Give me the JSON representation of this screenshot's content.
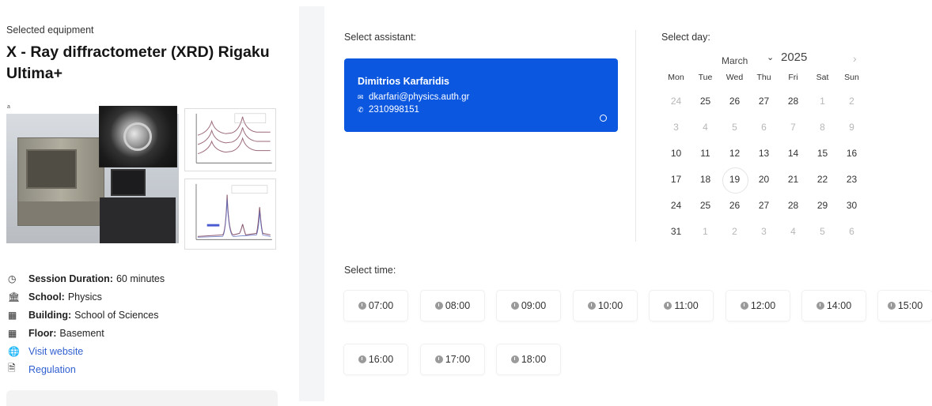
{
  "equipment": {
    "section_label": "Selected equipment",
    "title": "X - Ray diffractometer (XRD) Rigaku Ultima+",
    "details": [
      {
        "icon": "clock-icon",
        "label": "Session Duration:",
        "value": "60 minutes"
      },
      {
        "icon": "bank-icon",
        "label": "School:",
        "value": "Physics"
      },
      {
        "icon": "building-icon",
        "label": "Building:",
        "value": "School of Sciences"
      },
      {
        "icon": "building-icon",
        "label": "Floor:",
        "value": "Basement"
      }
    ],
    "links": [
      {
        "icon": "globe-icon",
        "text": "Visit website"
      },
      {
        "icon": "file-icon",
        "text": "Regulation"
      }
    ]
  },
  "assistant": {
    "section_label": "Select assistant:",
    "name": "Dimitrios Karfaridis",
    "email": "dkarfari@physics.auth.gr",
    "phone": "2310998151"
  },
  "calendar": {
    "section_label": "Select day:",
    "month": "March",
    "year": "2025",
    "weekdays": [
      "Mon",
      "Tue",
      "Wed",
      "Thu",
      "Fri",
      "Sat",
      "Sun"
    ],
    "weeks": [
      [
        {
          "d": "24",
          "m": true
        },
        {
          "d": "25",
          "m": false
        },
        {
          "d": "26",
          "m": false
        },
        {
          "d": "27",
          "m": false
        },
        {
          "d": "28",
          "m": false
        },
        {
          "d": "1",
          "m": true
        },
        {
          "d": "2",
          "m": true
        }
      ],
      [
        {
          "d": "3",
          "m": true
        },
        {
          "d": "4",
          "m": true
        },
        {
          "d": "5",
          "m": true
        },
        {
          "d": "6",
          "m": true
        },
        {
          "d": "7",
          "m": true
        },
        {
          "d": "8",
          "m": true
        },
        {
          "d": "9",
          "m": true
        }
      ],
      [
        {
          "d": "10",
          "m": false
        },
        {
          "d": "11",
          "m": false
        },
        {
          "d": "12",
          "m": false
        },
        {
          "d": "13",
          "m": false
        },
        {
          "d": "14",
          "m": false
        },
        {
          "d": "15",
          "m": false
        },
        {
          "d": "16",
          "m": false
        }
      ],
      [
        {
          "d": "17",
          "m": false
        },
        {
          "d": "18",
          "m": false
        },
        {
          "d": "19",
          "m": false,
          "today": true
        },
        {
          "d": "20",
          "m": false
        },
        {
          "d": "21",
          "m": false
        },
        {
          "d": "22",
          "m": false
        },
        {
          "d": "23",
          "m": false
        }
      ],
      [
        {
          "d": "24",
          "m": false
        },
        {
          "d": "25",
          "m": false
        },
        {
          "d": "26",
          "m": false
        },
        {
          "d": "27",
          "m": false
        },
        {
          "d": "28",
          "m": false
        },
        {
          "d": "29",
          "m": false
        },
        {
          "d": "30",
          "m": false
        }
      ],
      [
        {
          "d": "31",
          "m": false
        },
        {
          "d": "1",
          "m": true
        },
        {
          "d": "2",
          "m": true
        },
        {
          "d": "3",
          "m": true
        },
        {
          "d": "4",
          "m": true
        },
        {
          "d": "5",
          "m": true
        },
        {
          "d": "6",
          "m": true
        }
      ]
    ]
  },
  "time": {
    "section_label": "Select time:",
    "slots": [
      "07:00",
      "08:00",
      "09:00",
      "10:00",
      "11:00",
      "12:00",
      "14:00",
      "15:00",
      "16:00",
      "17:00",
      "18:00"
    ]
  }
}
